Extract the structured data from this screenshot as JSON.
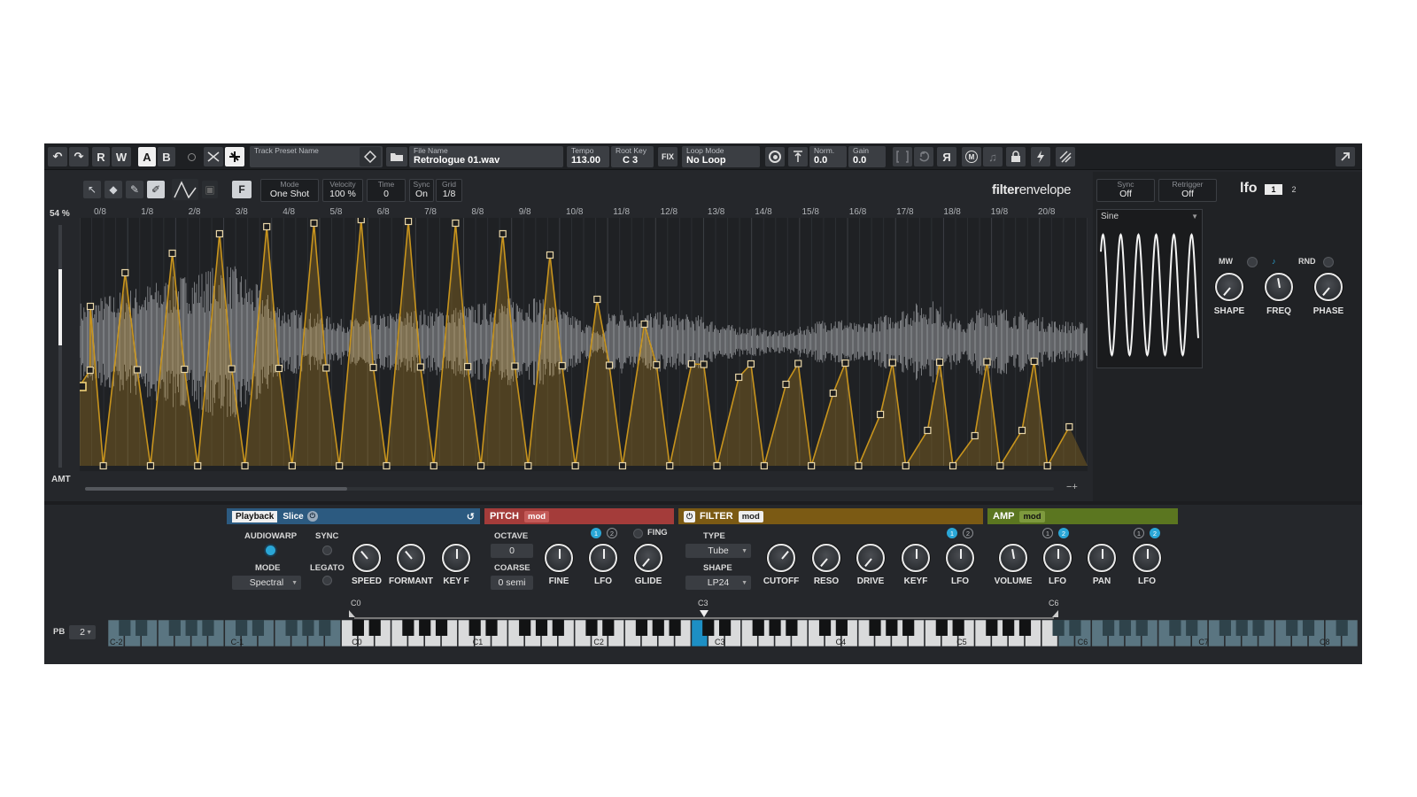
{
  "toolbar": {
    "undo": "↶",
    "redo": "↷",
    "r": "R",
    "w": "W",
    "a": "A",
    "b": "B",
    "preset_label": "Track Preset Name",
    "file_label": "File Name",
    "file_value": "Retrologue 01.wav",
    "tempo_label": "Tempo",
    "tempo_value": "113.00",
    "rootkey_label": "Root Key",
    "rootkey_value": "C 3",
    "fix": "FIX",
    "loop_label": "Loop Mode",
    "loop_value": "No Loop",
    "norm_label": "Norm.",
    "norm_value": "0.0",
    "gain_label": "Gain",
    "gain_value": "0.0",
    "reverse": "Я"
  },
  "editor": {
    "f_button": "F",
    "mode_label": "Mode",
    "mode_value": "One Shot",
    "velocity_label": "Velocity",
    "velocity_value": "100 %",
    "time_label": "Time",
    "time_value": "0",
    "sync_label": "Sync",
    "sync_value": "On",
    "grid_label": "Grid",
    "grid_value": "1/8",
    "brand_bold": "filter",
    "brand_light": "envelope",
    "percent": "54 %",
    "amt": "AMT",
    "zoom": "−+",
    "ticks": [
      "0/8",
      "1/8",
      "2/8",
      "3/8",
      "4/8",
      "5/8",
      "6/8",
      "7/8",
      "8/8",
      "9/8",
      "10/8",
      "11/8",
      "12/8",
      "13/8",
      "14/8",
      "15/8",
      "16/8",
      "17/8",
      "18/8",
      "19/8",
      "20/8"
    ]
  },
  "lfo": {
    "sync_label": "Sync",
    "sync_value": "Off",
    "retrigger_label": "Retrigger",
    "retrigger_value": "Off",
    "title": "lfo",
    "tab1": "1",
    "tab2": "2",
    "wave": "Sine",
    "mw": "MW",
    "rnd": "RND",
    "shape": "SHAPE",
    "freq": "FREQ",
    "phase": "PHASE"
  },
  "playback": {
    "tab_playback": "Playback",
    "tab_slice": "Slice",
    "audiowarp": "AUDIOWARP",
    "sync": "SYNC",
    "mode": "MODE",
    "mode_value": "Spectral",
    "legato": "LEGATO",
    "speed": "SPEED",
    "formant": "FORMANT",
    "keyf": "KEY F"
  },
  "pitch": {
    "title": "PITCH",
    "mod": "mod",
    "octave": "OCTAVE",
    "octave_value": "0",
    "coarse": "COARSE",
    "coarse_value": "0 semi",
    "fine": "FINE",
    "lfo": "LFO",
    "glide": "GLIDE",
    "fing": "FING",
    "n1": "1",
    "n2": "2"
  },
  "filter": {
    "title": "FILTER",
    "mod": "mod",
    "type": "TYPE",
    "type_value": "Tube",
    "shape": "SHAPE",
    "shape_value": "LP24",
    "cutoff": "CUTOFF",
    "reso": "RESO",
    "drive": "DRIVE",
    "keyf": "KEYF",
    "lfo": "LFO",
    "n1": "1",
    "n2": "2"
  },
  "amp": {
    "title": "AMP",
    "mod": "mod",
    "volume": "VOLUME",
    "lfo1": "LFO",
    "pan": "PAN",
    "lfo2": "LFO",
    "n1": "1",
    "n2": "2"
  },
  "keyboard": {
    "pb_label": "PB",
    "pb_value": "2",
    "marker_low": "C0",
    "marker_root": "C3",
    "marker_high": "C6",
    "octaves": [
      "C-2",
      "C-1",
      "C0",
      "C1",
      "C2",
      "C3",
      "C4",
      "C5",
      "C6",
      "C7",
      "C8"
    ]
  },
  "colors": {
    "playback": "#2c5a80",
    "pitch": "#a43c3a",
    "filter": "#7b5a14",
    "amp": "#5b7620",
    "envelope": "#c8941d",
    "accent": "#2aa6d6"
  }
}
